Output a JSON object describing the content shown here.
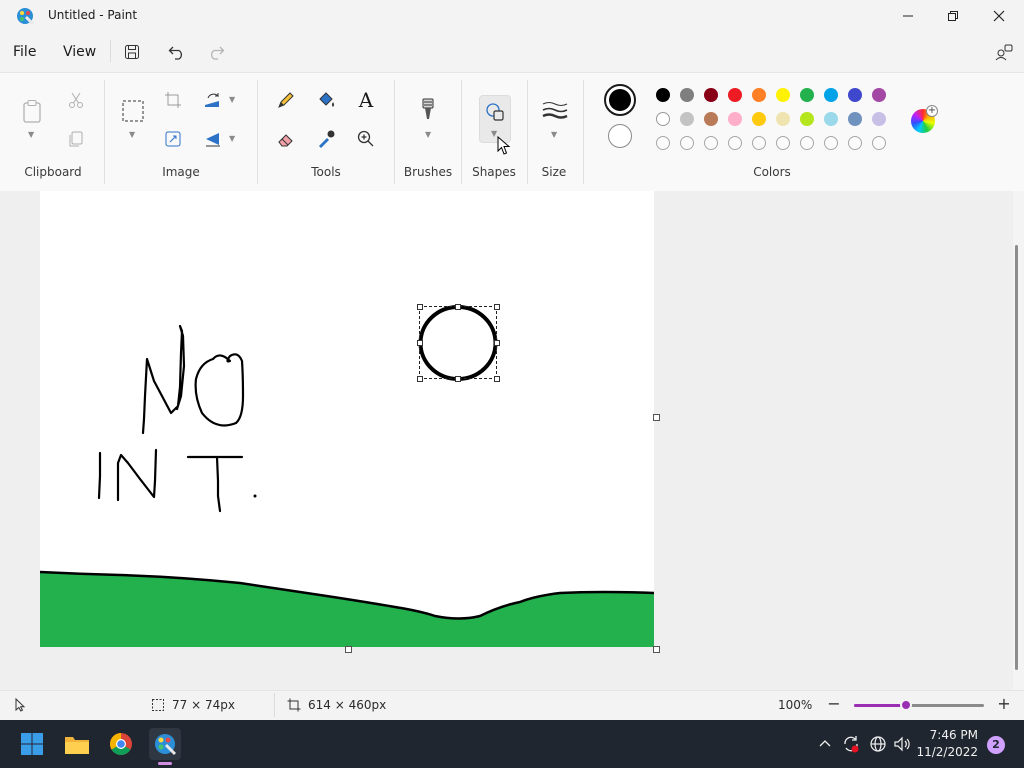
{
  "window": {
    "title": "Untitled - Paint"
  },
  "menu": {
    "file": "File",
    "view": "View"
  },
  "ribbon": {
    "groups": {
      "clipboard": "Clipboard",
      "image": "Image",
      "tools": "Tools",
      "brushes": "Brushes",
      "shapes": "Shapes",
      "size": "Size",
      "colors": "Colors"
    },
    "tool_glyphs": {
      "text": "A"
    }
  },
  "colors": {
    "primary": "#000000",
    "secondary": "#ffffff",
    "palette_row1": [
      "#000000",
      "#7f7f7f",
      "#880015",
      "#ed1c24",
      "#ff7f27",
      "#fff200",
      "#22b14c",
      "#00a2e8",
      "#3f48cc",
      "#a349a4"
    ],
    "palette_row2": [
      "#ffffff",
      "#c3c3c3",
      "#b97a57",
      "#ffaec9",
      "#ffc90e",
      "#efe4b0",
      "#b5e61d",
      "#99d9ea",
      "#7092be",
      "#c8bfe7"
    ],
    "palette_row3_empty_count": 10
  },
  "canvas": {
    "ground_color": "#22b14c",
    "text_drawn": "NO IN T."
  },
  "status": {
    "selection_size": "77 × 74px",
    "canvas_size": "614 × 460px",
    "zoom": "100%",
    "zoom_fraction": 0.4
  },
  "taskbar": {
    "time": "7:46 PM",
    "date": "11/2/2022",
    "notification_count": "2"
  }
}
